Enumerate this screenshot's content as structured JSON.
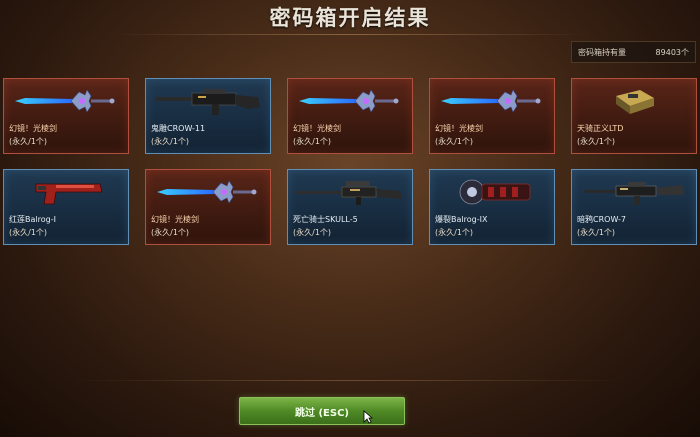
{
  "header": {
    "title": "密码箱开启结果"
  },
  "holdings": {
    "label": "密码箱持有量",
    "value": "89403个"
  },
  "items": [
    {
      "name": "幻镜！光棱剑",
      "duration": "(永久/1个)",
      "rarity": "red",
      "icon": "crystal-sword-icon"
    },
    {
      "name": "鬼雕CROW-11",
      "duration": "(永久/1个)",
      "rarity": "blue",
      "icon": "heavy-gun-icon"
    },
    {
      "name": "幻镜！光棱剑",
      "duration": "(永久/1个)",
      "rarity": "red",
      "icon": "crystal-sword-icon"
    },
    {
      "name": "幻镜！光棱剑",
      "duration": "(永久/1个)",
      "rarity": "red",
      "icon": "crystal-sword-icon"
    },
    {
      "name": "天骑正义LTD",
      "duration": "(永久/1个)",
      "rarity": "red",
      "icon": "equipment-icon"
    },
    {
      "name": "红莲Balrog-Ⅰ",
      "duration": "(永久/1个)",
      "rarity": "blue",
      "icon": "pistol-icon"
    },
    {
      "name": "幻镜！光棱剑",
      "duration": "(永久/1个)",
      "rarity": "red",
      "icon": "crystal-sword-icon"
    },
    {
      "name": "死亡骑士SKULL-5",
      "duration": "(永久/1个)",
      "rarity": "blue",
      "icon": "sniper-rifle-icon"
    },
    {
      "name": "爆裂Balrog-IX",
      "duration": "(永久/1个)",
      "rarity": "blue",
      "icon": "gauntlet-icon"
    },
    {
      "name": "暗鸦CROW-7",
      "duration": "(永久/1个)",
      "rarity": "blue",
      "icon": "rifle-icon"
    }
  ],
  "footer": {
    "skip_label": "跳过 (ESC)"
  },
  "colors": {
    "red_border": "#b0503c",
    "blue_border": "#5f8fb4",
    "button_green": "#4f8a26"
  }
}
